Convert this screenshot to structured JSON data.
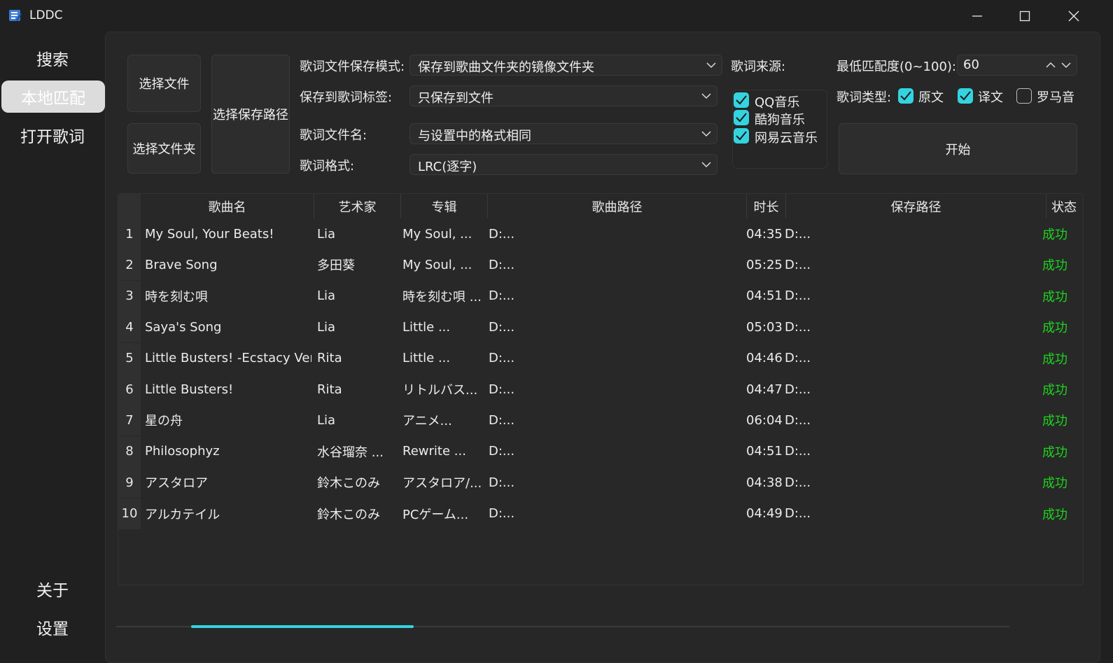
{
  "window": {
    "title": "LDDC"
  },
  "sidebar": {
    "items": [
      {
        "label": "搜索",
        "active": false
      },
      {
        "label": "本地匹配",
        "active": true
      },
      {
        "label": "打开歌词",
        "active": false
      }
    ],
    "bottom_items": [
      {
        "label": "关于"
      },
      {
        "label": "设置"
      }
    ]
  },
  "controls": {
    "select_file": "选择文件",
    "select_folder": "选择文件夹",
    "select_save_path": "选择保存路径",
    "save_mode_label": "歌词文件保存模式:",
    "save_mode_value": "保存到歌曲文件夹的镜像文件夹",
    "save_tag_label": "保存到歌词标签:",
    "save_tag_value": "只保存到文件",
    "filename_label": "歌词文件名:",
    "filename_value": "与设置中的格式相同",
    "format_label": "歌词格式:",
    "format_value": "LRC(逐字)",
    "source_label": "歌词来源:",
    "sources": [
      {
        "label": "QQ音乐",
        "checked": true
      },
      {
        "label": "酷狗音乐",
        "checked": true
      },
      {
        "label": "网易云音乐",
        "checked": true
      }
    ],
    "min_match_label": "最低匹配度(0~100):",
    "min_match_value": "60",
    "lyric_type_label": "歌词类型:",
    "lyric_types": [
      {
        "label": "原文",
        "checked": true
      },
      {
        "label": "译文",
        "checked": true
      },
      {
        "label": "罗马音",
        "checked": false
      }
    ],
    "start_button": "开始"
  },
  "table": {
    "headers": [
      "歌曲名",
      "艺术家",
      "专辑",
      "歌曲路径",
      "时长",
      "保存路径",
      "状态"
    ],
    "rows": [
      {
        "num": "1",
        "song": "My Soul, Your Beats!",
        "artist": "Lia",
        "album": "My Soul, ...",
        "path": "D:...",
        "duration": "04:35",
        "save": "D:...",
        "status": "成功"
      },
      {
        "num": "2",
        "song": "Brave Song",
        "artist": "多田葵",
        "album": "My Soul, ...",
        "path": "D:...",
        "duration": "05:25",
        "save": "D:...",
        "status": "成功"
      },
      {
        "num": "3",
        "song": "時を刻む唄",
        "artist": "Lia",
        "album": "時を刻む唄 ...",
        "path": "D:...",
        "duration": "04:51",
        "save": "D:...",
        "status": "成功"
      },
      {
        "num": "4",
        "song": "Saya's Song",
        "artist": "Lia",
        "album": "Little ...",
        "path": "D:...",
        "duration": "05:03",
        "save": "D:...",
        "status": "成功"
      },
      {
        "num": "5",
        "song": "Little Busters! -Ecstacy Ver.-",
        "artist": "Rita",
        "album": "Little ...",
        "path": "D:...",
        "duration": "04:46",
        "save": "D:...",
        "status": "成功"
      },
      {
        "num": "6",
        "song": "Little Busters!",
        "artist": "Rita",
        "album": "リトルバス...",
        "path": "D:...",
        "duration": "04:47",
        "save": "D:...",
        "status": "成功"
      },
      {
        "num": "7",
        "song": "星の舟",
        "artist": "Lia",
        "album": "アニメ...",
        "path": "D:...",
        "duration": "06:04",
        "save": "D:...",
        "status": "成功"
      },
      {
        "num": "8",
        "song": "Philosophyz",
        "artist": "水谷瑠奈 ...",
        "album": "Rewrite ...",
        "path": "D:...",
        "duration": "04:51",
        "save": "D:...",
        "status": "成功"
      },
      {
        "num": "9",
        "song": "アスタロア",
        "artist": "鈴木このみ",
        "album": "アスタロア/...",
        "path": "D:...",
        "duration": "04:38",
        "save": "D:...",
        "status": "成功"
      },
      {
        "num": "10",
        "song": "アルカテイル",
        "artist": "鈴木このみ",
        "album": "PCゲーム...",
        "path": "D:...",
        "duration": "04:49",
        "save": "D:...",
        "status": "成功"
      }
    ]
  },
  "progress": {
    "fraction": null
  },
  "colors": {
    "accent": "#34d3e0",
    "success": "#1ed31e"
  }
}
